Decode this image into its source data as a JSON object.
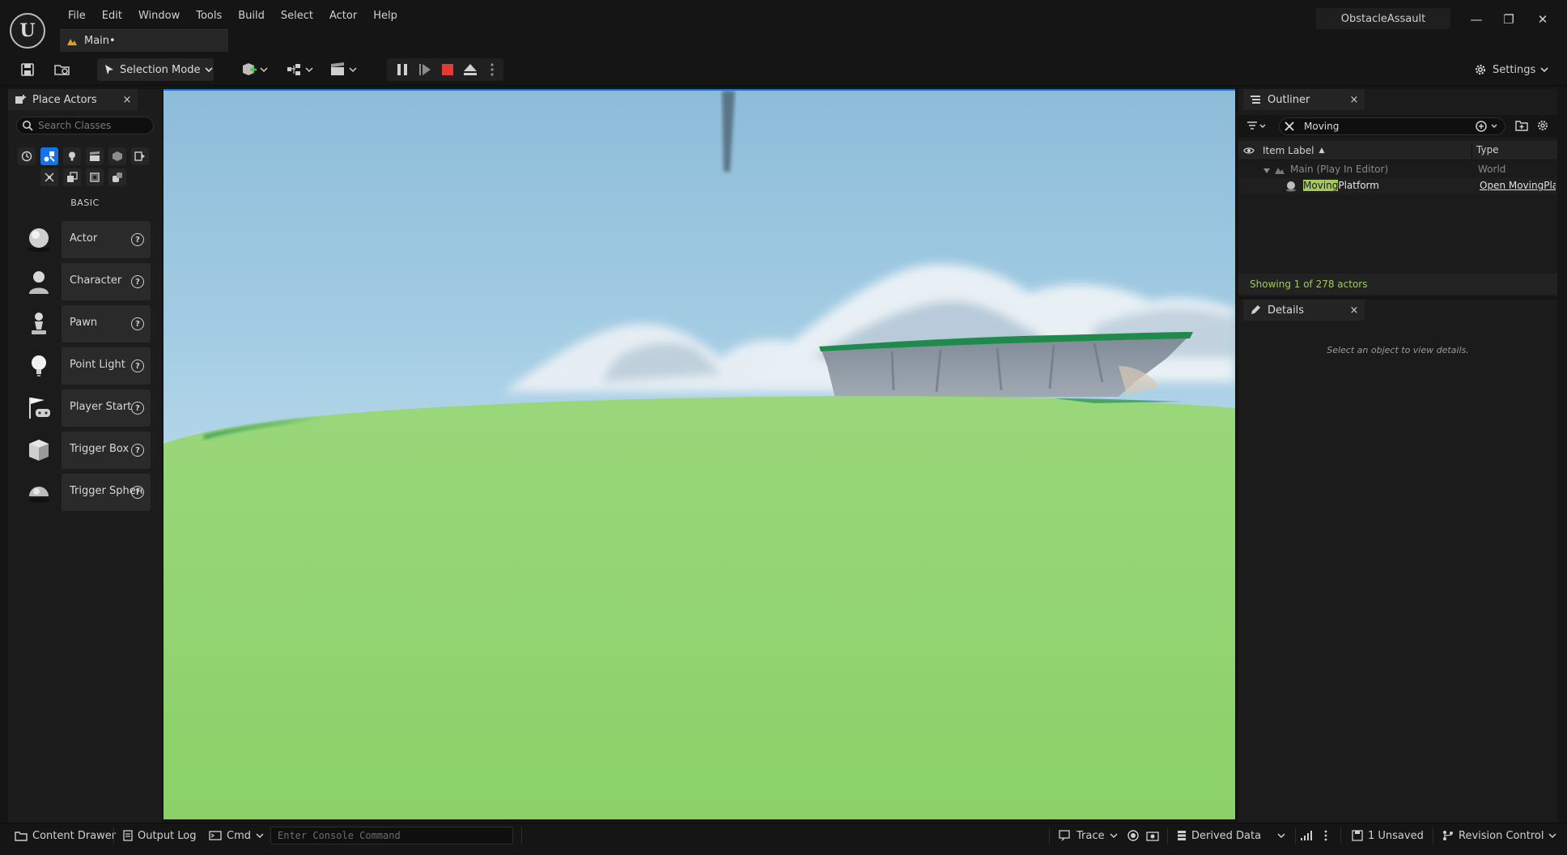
{
  "window": {
    "logo_text": "U",
    "project_name": "ObstacleAssault",
    "minimize_glyph": "—",
    "maximize_glyph": "❐",
    "close_glyph": "✕"
  },
  "menu": [
    "File",
    "Edit",
    "Window",
    "Tools",
    "Build",
    "Select",
    "Actor",
    "Help"
  ],
  "document_tab": {
    "label": "Main•"
  },
  "toolbar": {
    "selection_mode": "Selection Mode",
    "settings": "Settings"
  },
  "place_actors": {
    "tab_label": "Place Actors",
    "close_glyph": "×",
    "search_placeholder": "Search Classes",
    "section_label": "BASIC",
    "help_glyph": "?",
    "items": [
      {
        "label": "Actor",
        "icon": "sphere-icon"
      },
      {
        "label": "Character",
        "icon": "character-icon"
      },
      {
        "label": "Pawn",
        "icon": "pawn-icon"
      },
      {
        "label": "Point Light",
        "icon": "light-bulb-icon"
      },
      {
        "label": "Player Start",
        "icon": "player-start-icon"
      },
      {
        "label": "Trigger Box",
        "icon": "cube-icon"
      },
      {
        "label": "Trigger Sphere",
        "icon": "sphere-icon"
      }
    ]
  },
  "outliner": {
    "tab_label": "Outliner",
    "close_glyph": "×",
    "search_value": "Moving",
    "col_item_label": "Item Label",
    "col_type": "Type",
    "sort_glyph": "▲",
    "rows": [
      {
        "label": "Main (Play In Editor)",
        "type": "World"
      },
      {
        "label_highlight": "Moving",
        "label_rest": "Platform",
        "type": "Open MovingPlatform"
      }
    ],
    "showing": "Showing 1 of 278 actors"
  },
  "details": {
    "tab_label": "Details",
    "close_glyph": "×",
    "empty_text": "Select an object to view details."
  },
  "statusbar": {
    "content_drawer": "Content Drawer",
    "output_log": "Output Log",
    "cmd": "Cmd",
    "console_placeholder": "Enter Console Command",
    "trace": "Trace",
    "derived_data": "Derived Data",
    "unsaved": "1 Unsaved",
    "revision_control": "Revision Control"
  },
  "colors": {
    "accent": "#1473e6",
    "grass": "#8fd46c",
    "highlight": "#a3c85b"
  }
}
